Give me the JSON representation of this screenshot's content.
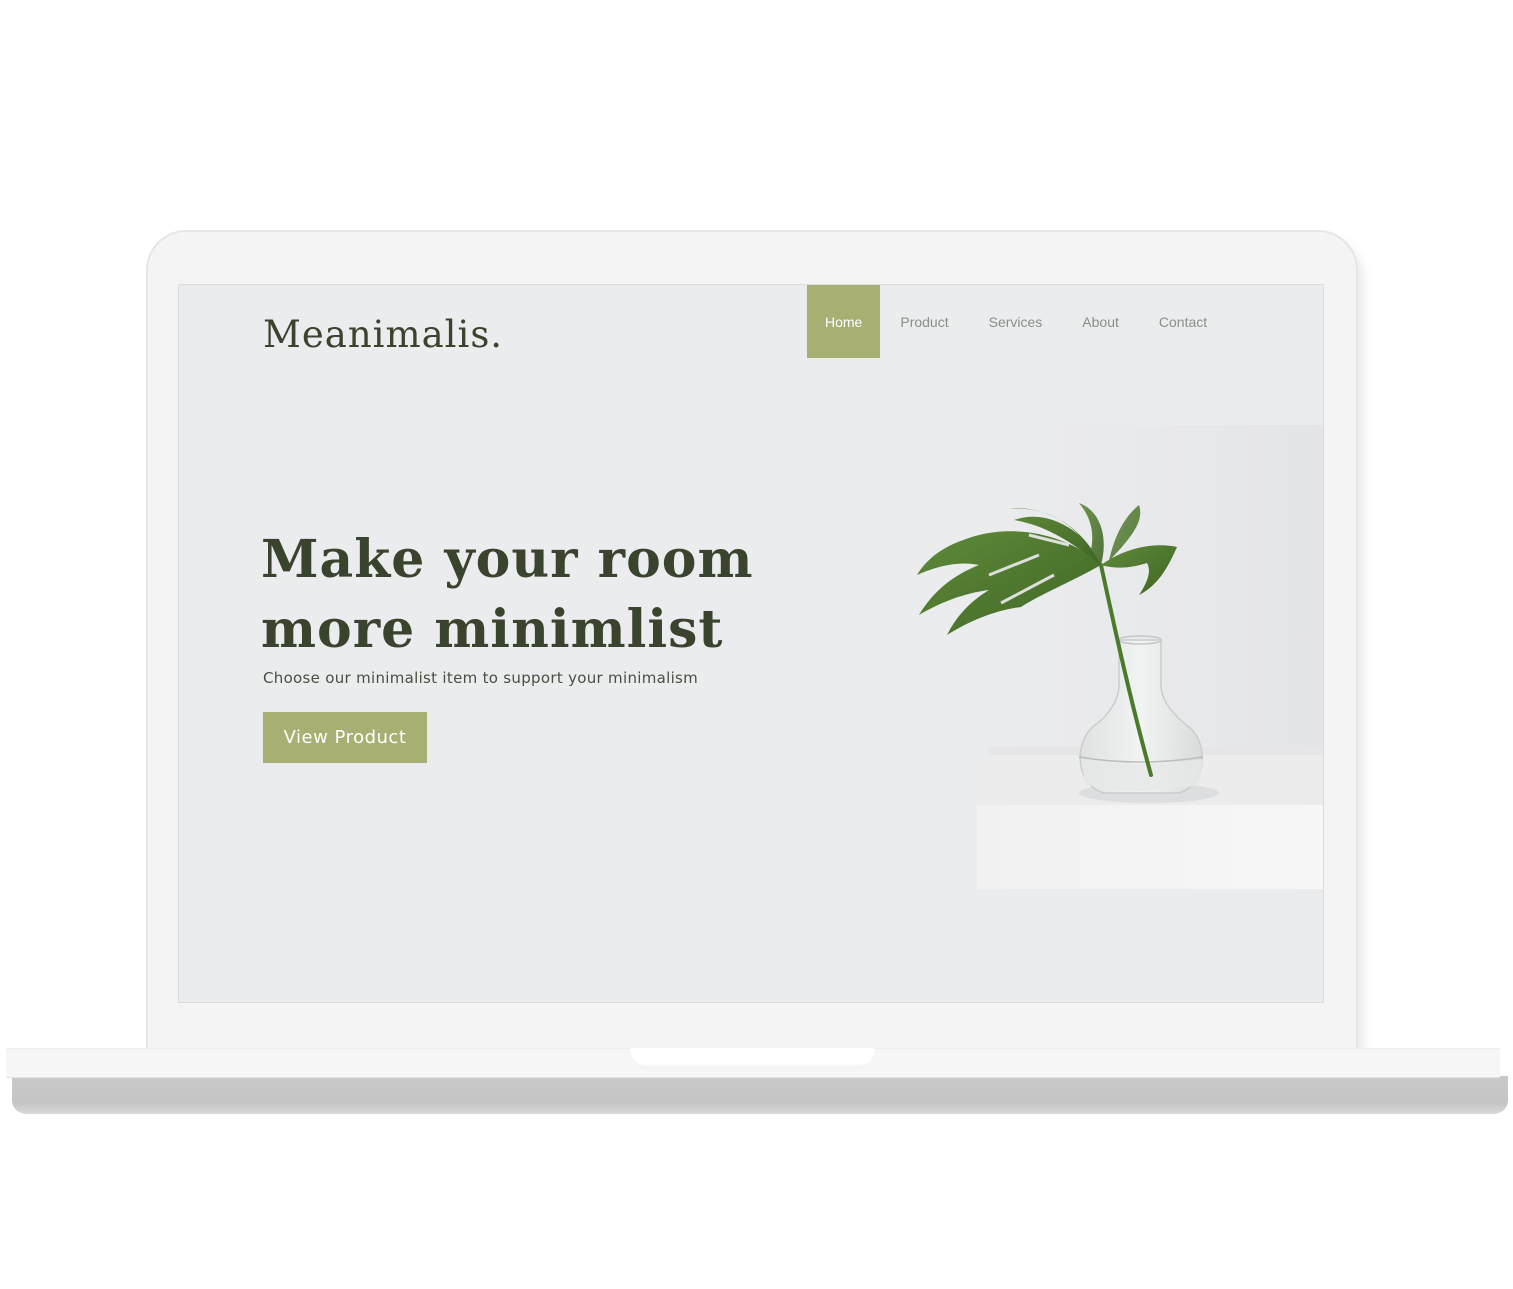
{
  "site": {
    "logo": "Meanimalis.",
    "nav": [
      {
        "label": "Home",
        "active": true
      },
      {
        "label": "Product",
        "active": false
      },
      {
        "label": "Services",
        "active": false
      },
      {
        "label": "About",
        "active": false
      },
      {
        "label": "Contact",
        "active": false
      }
    ]
  },
  "hero": {
    "headline_line1": "Make your room",
    "headline_line2": "more minimlist",
    "subtitle": "Choose our minimalist item to support your minimalism",
    "cta_label": "View Product",
    "image_icon": "plant-in-vase-image"
  },
  "colors": {
    "accent": "#a7af72",
    "heading": "#3a432d",
    "screen_bg": "#ebecee",
    "nav_text": "#8b8e86"
  }
}
